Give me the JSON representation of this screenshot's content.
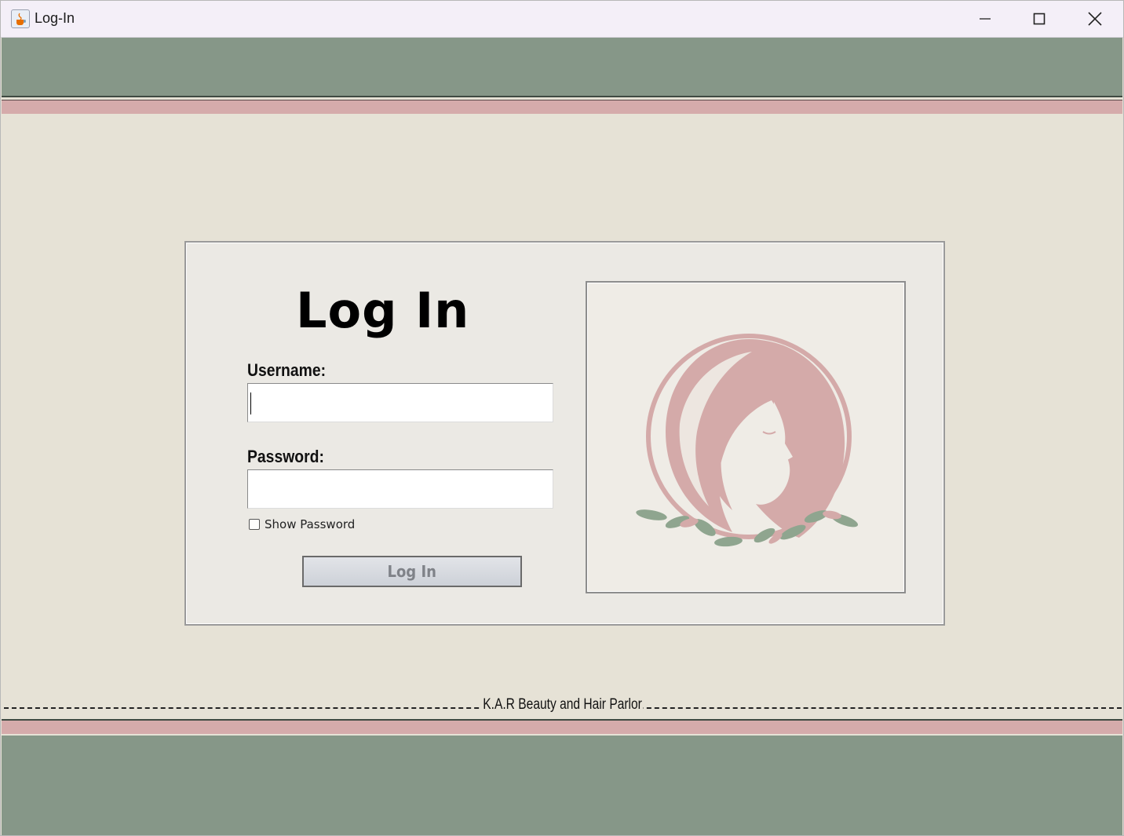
{
  "window": {
    "title": "Log-In"
  },
  "login": {
    "heading": "Log In",
    "username_label": "Username:",
    "username_value": "",
    "password_label": "Password:",
    "password_value": "",
    "show_password_label": "Show Password",
    "show_password_checked": false,
    "button_label": "Log In"
  },
  "footer": {
    "text": "K.A.R Beauty and Hair Parlor"
  },
  "colors": {
    "green": "#869788",
    "pink": "#d5abab",
    "background": "#e6e2d6",
    "card": "#ebe9e4",
    "logo_pink": "#d4aaa9",
    "leaf_green": "#8fa58f"
  }
}
